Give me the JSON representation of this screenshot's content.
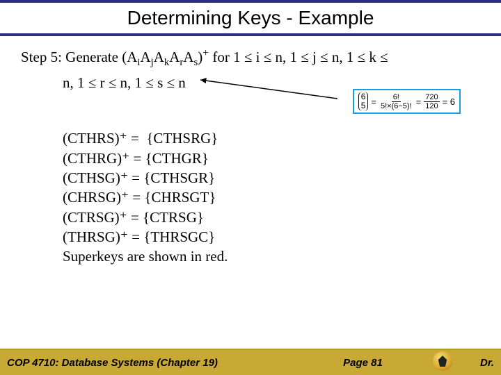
{
  "title": "Determining Keys - Example",
  "step": {
    "line1_prefix": "Step 5: Generate (A",
    "sub_i": "i",
    "a2": "A",
    "sub_j": "j",
    "a3": "A",
    "sub_k": "k",
    "a4": "A",
    "sub_r": "r",
    "a5": "A",
    "sub_s": "s",
    "line1_mid": ")",
    "sup_plus": "+",
    "line1_tail": " for 1 ≤ i ≤ n, 1 ≤ j ≤ n, 1 ≤ k ≤",
    "line2": "n, 1 ≤ r ≤ n, 1 ≤ s ≤ n"
  },
  "closures": [
    "(CTHRS)⁺ =  {CTHSRG}",
    "(CTHRG)⁺ = {CTHGR}",
    "(CTHSG)⁺ = {CTHSGR}",
    "(CHRSG)⁺ = {CHRSGT}",
    "(CTRSG)⁺ = {CTRSG}",
    "(THRSG)⁺ = {THRSGC}",
    "Superkeys are shown in red."
  ],
  "formula": {
    "binom_top": "6",
    "binom_bot": "5",
    "eq1": "=",
    "f1_num": "6!",
    "f1_den": "5!×(6−5)!",
    "eq2": "=",
    "f2_num": "720",
    "f2_den": "120",
    "eq3": "= 6"
  },
  "footer": {
    "left": "COP 4710: Database Systems  (Chapter 19)",
    "center": "Page 81",
    "right": "Dr."
  }
}
